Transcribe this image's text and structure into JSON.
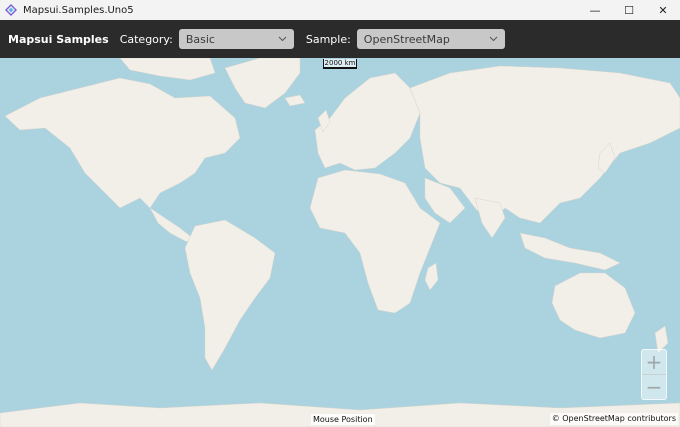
{
  "window": {
    "title": "Mapsui.Samples.Uno5",
    "minimize_glyph": "—",
    "maximize_glyph": "☐",
    "close_glyph": "✕"
  },
  "toolbar": {
    "app_name": "Mapsui Samples",
    "category_label": "Category:",
    "category_value": "Basic",
    "sample_label": "Sample:",
    "sample_value": "OpenStreetMap"
  },
  "map": {
    "scale_text": "2000 km",
    "zoom_in": "+",
    "zoom_out": "−",
    "mouse_position": "Mouse Position",
    "attribution": "© OpenStreetMap contributors",
    "colors": {
      "water": "#aad3df",
      "land": "#f2efe9"
    }
  }
}
